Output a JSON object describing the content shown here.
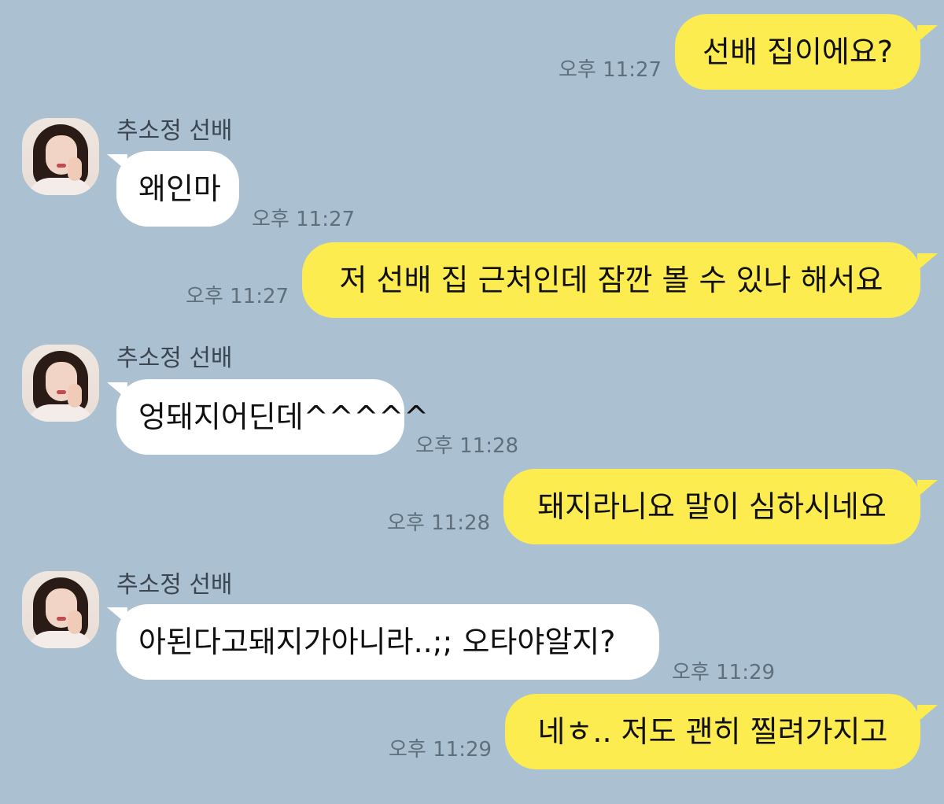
{
  "chat": {
    "contact_name": "추소정 선배",
    "messages": [
      {
        "sender": "me",
        "text": "선배 집이에요?",
        "time": "오후 11:27"
      },
      {
        "sender": "other",
        "text": "왜인마",
        "time": "오후 11:27"
      },
      {
        "sender": "me",
        "text": "저 선배 집 근처인데 잠깐 볼 수 있나 해서요",
        "time": "오후 11:27"
      },
      {
        "sender": "other",
        "text": "엉돼지어딘데^^^^^",
        "time": "오후 11:28"
      },
      {
        "sender": "me",
        "text": "돼지라니요 말이 심하시네요",
        "time": "오후 11:28"
      },
      {
        "sender": "other",
        "text": "아된다고돼지가아니라..;; 오타야알지?",
        "time": "오후 11:29"
      },
      {
        "sender": "me",
        "text": "네ㅎ.. 저도 괜히 찔려가지고",
        "time": "오후 11:29"
      }
    ]
  },
  "colors": {
    "background": "#abc1d1",
    "my_bubble": "#fcec4f",
    "their_bubble": "#ffffff"
  },
  "icons": {
    "avatar": "contact-profile-photo"
  }
}
